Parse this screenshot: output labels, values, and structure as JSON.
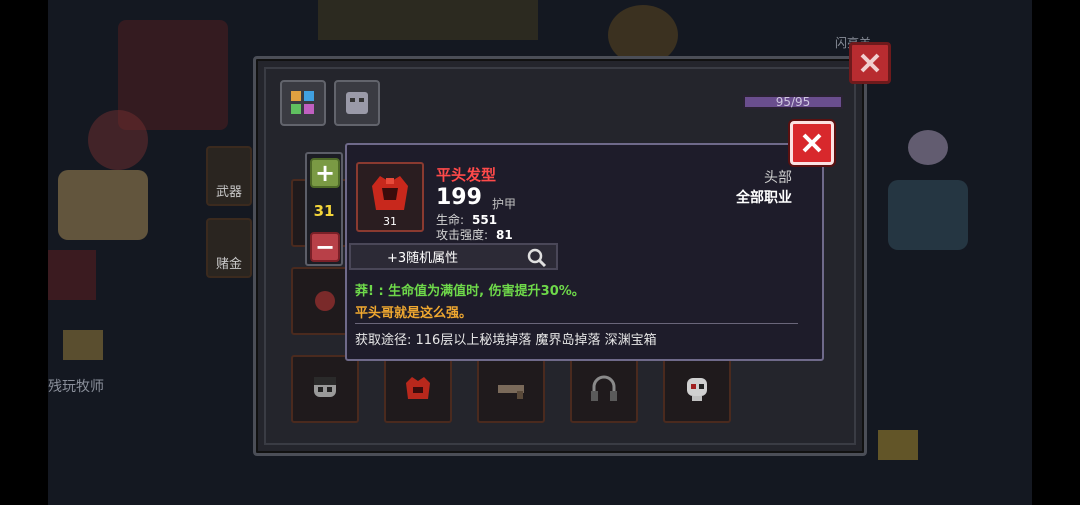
{
  "background": {
    "weapon_label": "武器",
    "bet_label": "赌金",
    "player_label": "残玩牧师",
    "top_label": "闪亮羊"
  },
  "panel": {
    "exp_text": "95/95",
    "exp_fraction": 1.0
  },
  "stepper": {
    "plus": "+",
    "minus": "−",
    "value": "31"
  },
  "tooltip": {
    "name": "平头发型",
    "armor_value": "199",
    "armor_label": "护甲",
    "level": "31",
    "stats": [
      {
        "label": "生命:",
        "value": "551"
      },
      {
        "label": "攻击强度:",
        "value": "81"
      }
    ],
    "slot_type": "头部",
    "class_type": "全部职业",
    "random_attr": "+3随机属性",
    "desc_effect": "莽! : 生命值为满值时, 伤害提升30%。",
    "desc_flavor": "平头哥就是这么强。",
    "source": "获取途径: 116层以上秘境掉落 魔界岛掉落 深渊宝箱"
  },
  "colors": {
    "name_red": "#ff4a4a",
    "effect_green": "#6ed84a",
    "flavor_orange": "#f0a830",
    "close_red": "#d8282c"
  },
  "icons": {
    "close": "close-icon",
    "helmet": "red-helmet-icon",
    "magnifier": "magnifier-icon"
  }
}
